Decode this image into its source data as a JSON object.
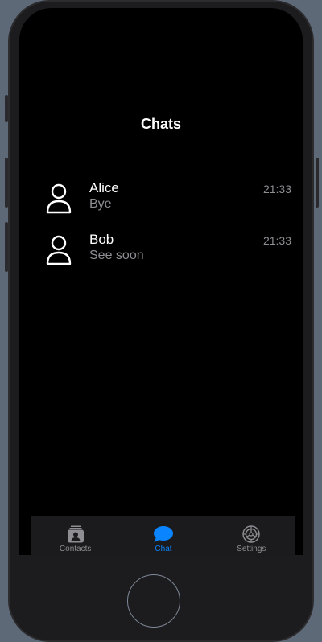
{
  "nav": {
    "title": "Chats"
  },
  "chats": [
    {
      "name": "Alice",
      "last_message": "Bye",
      "time": "21:33",
      "icon": "person-icon"
    },
    {
      "name": "Bob",
      "last_message": "See soon",
      "time": "21:33",
      "icon": "person-icon"
    }
  ],
  "tabbar": {
    "tabs": [
      {
        "label": "Contacts",
        "icon": "contacts-icon",
        "active": false
      },
      {
        "label": "Chat",
        "icon": "chat-bubble-icon",
        "active": true
      },
      {
        "label": "Settings",
        "icon": "gear-icon",
        "active": false
      }
    ]
  },
  "colors": {
    "accent": "#0a84ff",
    "background": "#000000",
    "secondary_text": "#8e8e93"
  }
}
